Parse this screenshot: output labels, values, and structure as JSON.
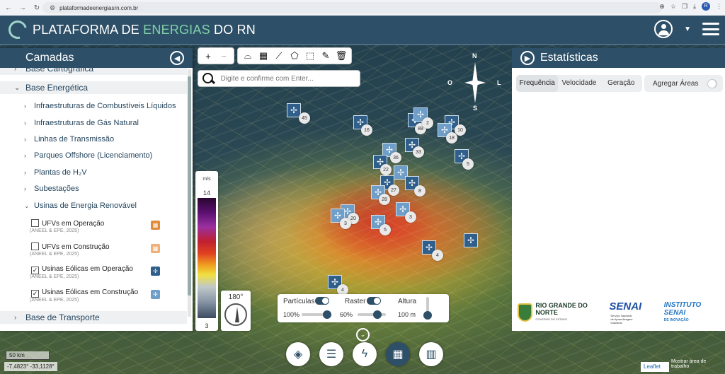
{
  "browser": {
    "url": "plataformadeenergiasrn.com.br",
    "profile_initial": "R"
  },
  "header": {
    "title_part1": "PLATAFORMA DE ",
    "title_part2": "ENERGIAS",
    "title_part3": " DO RN"
  },
  "layers": {
    "title": "Camadas",
    "groups": [
      {
        "label": "Base Cartográfica"
      },
      {
        "label": "Base Energética"
      },
      {
        "label": "Base de Transporte"
      }
    ],
    "energy_items": [
      "Infraestruturas de Combustíveis Líquidos",
      "Infraestruturas de Gás Natural",
      "Linhas de Transmissão",
      "Parques Offshore (Licenciamento)",
      "Plantas de H₂V",
      "Subestações",
      "Usinas de Energia Renovável"
    ],
    "renewable": [
      {
        "label": "UFVs em Operação",
        "source": "(ANEEL & EPE, 2025)",
        "checked": "",
        "icon": "solar-panel-icon",
        "color": "#e08a3a"
      },
      {
        "label": "UFVs em Construção",
        "source": "(ANEEL & EPE, 2025)",
        "checked": "",
        "icon": "solar-panel-icon",
        "color": "#f0b07a"
      },
      {
        "label": "Usinas Eólicas em Operação",
        "source": "(ANEEL & EPE, 2025)",
        "checked": "✓",
        "icon": "wind-turbine-icon",
        "color": "#2f5f8a"
      },
      {
        "label": "Usinas Eólicas em Construção",
        "source": "(ANEEL & EPE, 2025)",
        "checked": "✓",
        "icon": "wind-turbine-icon",
        "color": "#6f9ec8"
      }
    ]
  },
  "search": {
    "placeholder": "Digite e confirme com Enter..."
  },
  "scale_legend": {
    "unit": "m/s",
    "max": "14",
    "min": "3"
  },
  "wind_direction": "180°",
  "controls": {
    "particles_label": "Partículas",
    "particles_value": "100%",
    "raster_label": "Raster",
    "raster_value": "60%",
    "height_label": "Altura",
    "height_value": "100 m"
  },
  "compass": {
    "n": "N",
    "s": "S",
    "o": "O",
    "l": "L"
  },
  "stats": {
    "title": "Estatísticas",
    "tabs": [
      "Frequência",
      "Velocidade",
      "Geração"
    ],
    "aggregate_label": "Agregar Áreas",
    "logo_rn": "RIO GRANDE DO NORTE",
    "logo_rn_sub": "GOVERNO DO ESTADO",
    "logo_senai": "SENAI",
    "logo_senai_sub": "Serviço Nacional de Aprendizagem Industrial",
    "logo_inst": "INSTITUTO SENAI",
    "logo_inst_sub": "DE INOVAÇÃO"
  },
  "markers": [
    {
      "count": "45"
    },
    {
      "count": "16"
    },
    {
      "count": "88"
    },
    {
      "count": "2"
    },
    {
      "count": "10"
    },
    {
      "count": "18"
    },
    {
      "count": "36"
    },
    {
      "count": "33"
    },
    {
      "count": "5"
    },
    {
      "count": "22"
    },
    {
      "count": "27"
    },
    {
      "count": "28"
    },
    {
      "count": "8"
    },
    {
      "count": "3"
    },
    {
      "count": "20"
    },
    {
      "count": "3"
    },
    {
      "count": "5"
    },
    {
      "count": "4"
    },
    {
      "count": "4"
    }
  ],
  "map_footer": {
    "scale": "50 km",
    "coords": "-7,4823° -33,1128°",
    "attribution": "Leaflet",
    "overlay_text": "Mostrar área de trabalho"
  }
}
